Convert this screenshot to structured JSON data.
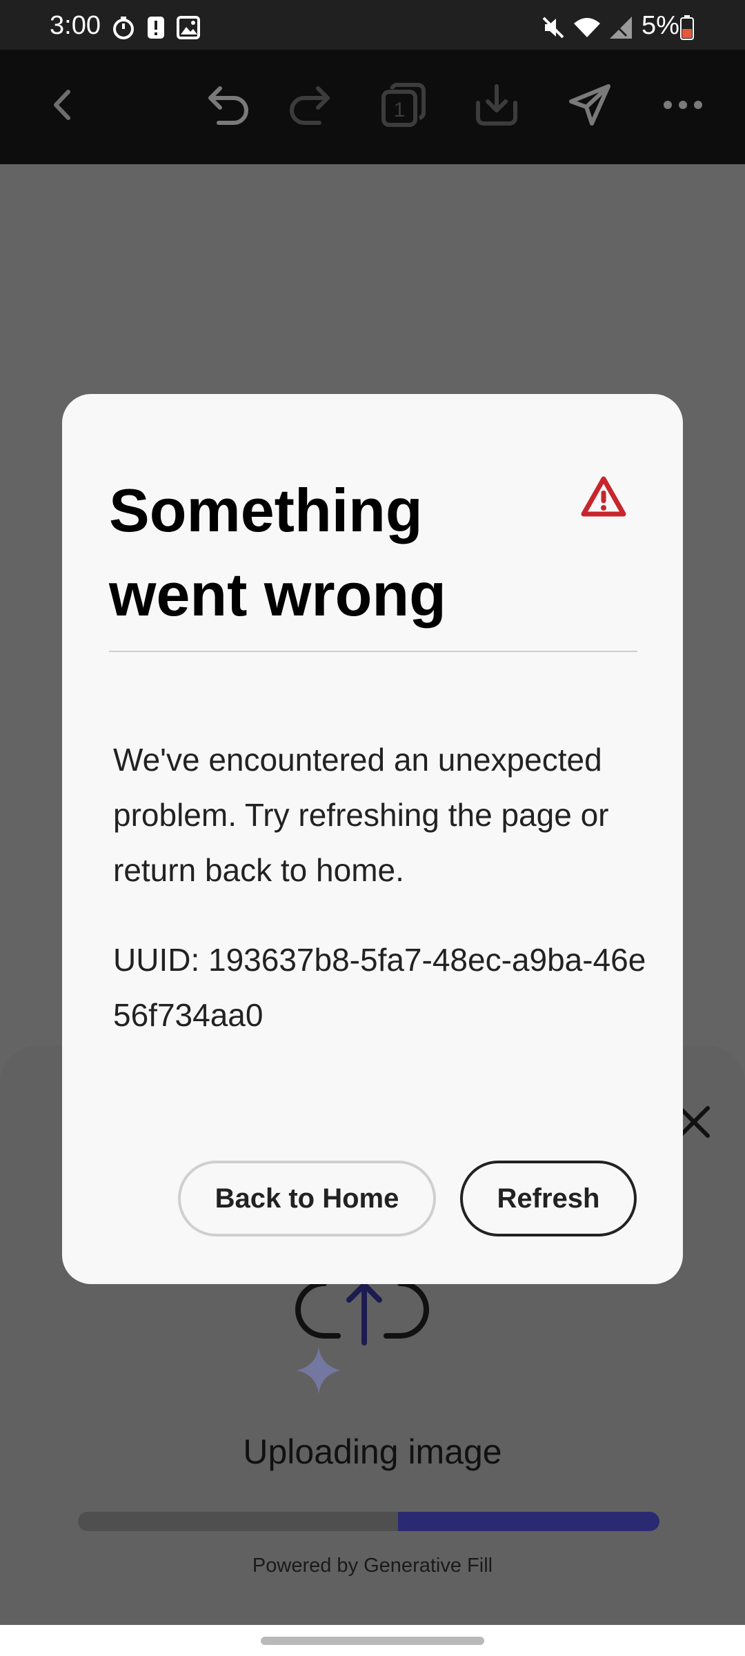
{
  "status_bar": {
    "time": "3:00",
    "battery": "5%",
    "left_icons": [
      "timer-icon",
      "alert-notification-icon",
      "image-notification-icon"
    ],
    "right_icons": [
      "mute-icon",
      "wifi-icon",
      "signal-icon",
      "battery-icon"
    ]
  },
  "toolbar": {
    "icons": [
      "back-icon",
      "undo-icon",
      "redo-icon",
      "pages-icon",
      "download-icon",
      "send-icon",
      "more-icon"
    ],
    "pages_count": "1"
  },
  "dialog": {
    "title": "Something went wrong",
    "body": "We've encountered an unexpected problem. Try refreshing the page or return back to home.",
    "uuid": "UUID: 193637b8-5fa7-48ec-a9ba-46e56f734aa0",
    "back_home_label": "Back to Home",
    "refresh_label": "Refresh"
  },
  "sheet": {
    "uploading_label": "Uploading image",
    "powered_by": "Powered by Generative Fill",
    "progress": 0.45
  },
  "colors": {
    "alert": "#c9252c",
    "progress": "#2a2a72",
    "sparkle": "#7478a0"
  }
}
